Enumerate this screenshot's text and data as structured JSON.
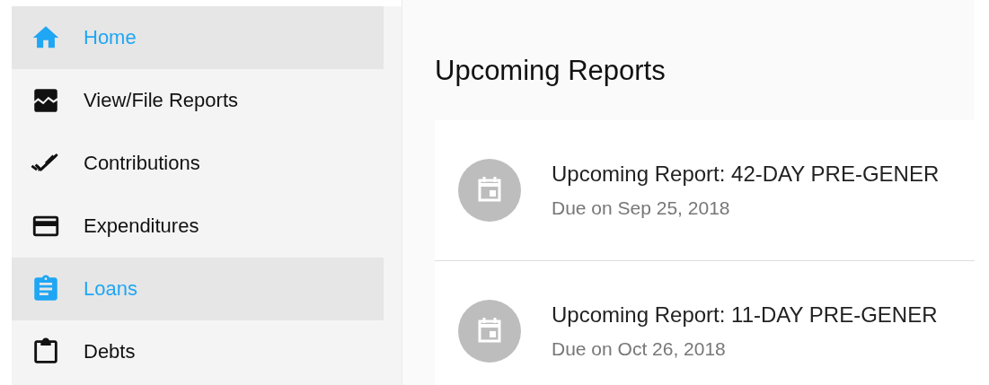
{
  "sidebar": {
    "items": [
      {
        "label": "Home",
        "kind": "home",
        "selected": true
      },
      {
        "label": "View/File Reports",
        "kind": "chart",
        "selected": false
      },
      {
        "label": "Contributions",
        "kind": "checks",
        "selected": false
      },
      {
        "label": "Expenditures",
        "kind": "card",
        "selected": false
      },
      {
        "label": "Loans",
        "kind": "assignment",
        "selected": true
      },
      {
        "label": "Debts",
        "kind": "clipboard",
        "selected": false
      }
    ]
  },
  "main": {
    "title": "Upcoming Reports",
    "reports": [
      {
        "title": "Upcoming Report: 42-DAY PRE-GENER",
        "due": "Due on Sep 25, 2018"
      },
      {
        "title": "Upcoming Report: 11-DAY PRE-GENER",
        "due": "Due on Oct 26, 2018"
      }
    ]
  }
}
